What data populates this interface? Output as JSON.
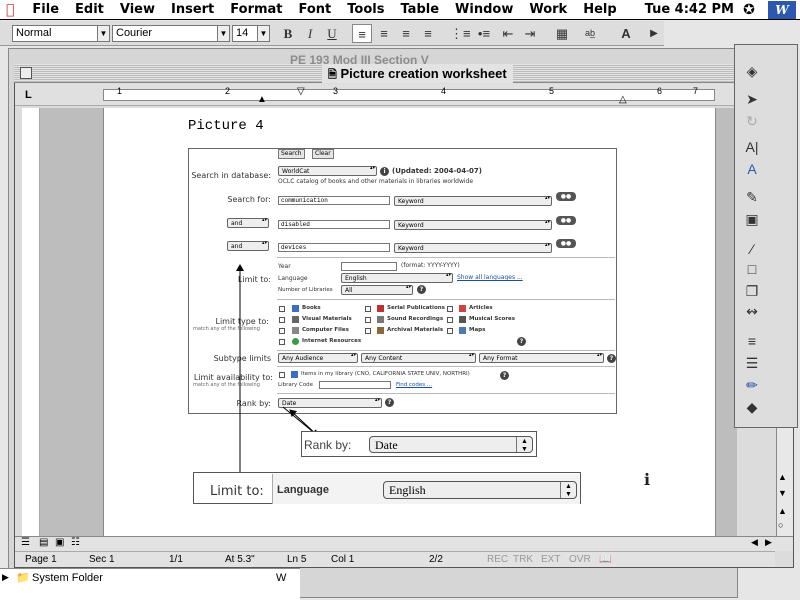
{
  "menubar": {
    "apple": "",
    "items": [
      "File",
      "Edit",
      "View",
      "Insert",
      "Format",
      "Font",
      "Tools",
      "Table",
      "Window",
      "Work",
      "Help"
    ],
    "clock": "Tue 4:42 PM",
    "app_badge": "W"
  },
  "format_toolbar": {
    "style": "Normal",
    "font": "Courier",
    "size": "14",
    "bold": "B",
    "italic": "I",
    "underline": "U"
  },
  "background_window_title": "PE 193 Mod III Section V",
  "window": {
    "title": "Picture creation worksheet"
  },
  "ruler": {
    "marks": [
      "1",
      "2",
      "3",
      "4",
      "5",
      "6",
      "7"
    ],
    "tab_label": "L"
  },
  "document": {
    "heading": "Picture 4"
  },
  "embedded": {
    "search_button": "Search",
    "clear_button": "Clear",
    "search_in_database_label": "Search in database:",
    "database_value": "WorldCat",
    "updated": "(Updated: 2004-04-07)",
    "database_desc": "OCLC catalog of books and other materials in libraries worldwide",
    "search_for_label": "Search for:",
    "term1": "communication",
    "index1": "Keyword",
    "bool2": "and",
    "term2": "disabled",
    "index2": "Keyword",
    "bool3": "and",
    "term3": "devices",
    "index3": "Keyword",
    "limit_to_label": "Limit to:",
    "year_label": "Year",
    "year_format": "(format: YYYY-YYYY)",
    "language_label": "Language",
    "language_value": "English",
    "show_all_languages": "Show all languages ...",
    "num_libraries_label": "Number of Libraries",
    "num_libraries_value": "All",
    "limit_type_label": "Limit type to:",
    "limit_type_sub": "match any of the following",
    "types": [
      "Books",
      "Visual Materials",
      "Computer Files",
      "Internet Resources",
      "Serial Publications",
      "Sound Recordings",
      "Archival Materials",
      "Articles",
      "Musical Scores",
      "Maps"
    ],
    "subtype_label": "Subtype limits",
    "subtype1": "Any Audience",
    "subtype2": "Any Content",
    "subtype3": "Any Format",
    "limit_avail_label": "Limit availability to:",
    "limit_avail_sub": "match any of the following",
    "items_in_library": "Items in my library (CNO, CALIFORNIA STATE UNIV, NORTHRI)",
    "library_code_label": "Library Code",
    "find_codes": "Find codes ...",
    "rank_by_label": "Rank by:",
    "rank_by_value": "Date"
  },
  "callouts": {
    "rank_by_label": "Rank by:",
    "rank_by_value": "Date",
    "limit_to_label": "Limit to:",
    "language_label": "Language",
    "language_value": "English"
  },
  "status": {
    "page": "Page 1",
    "sec": "Sec 1",
    "pages": "1/1",
    "at": "At 5.3\"",
    "ln": "Ln 5",
    "col": "Col 1",
    "count": "2/2",
    "rec": "REC",
    "trk": "TRK",
    "ext": "EXT",
    "ovr": "OVR"
  },
  "finder": {
    "item": "System Folder",
    "side": "W"
  }
}
